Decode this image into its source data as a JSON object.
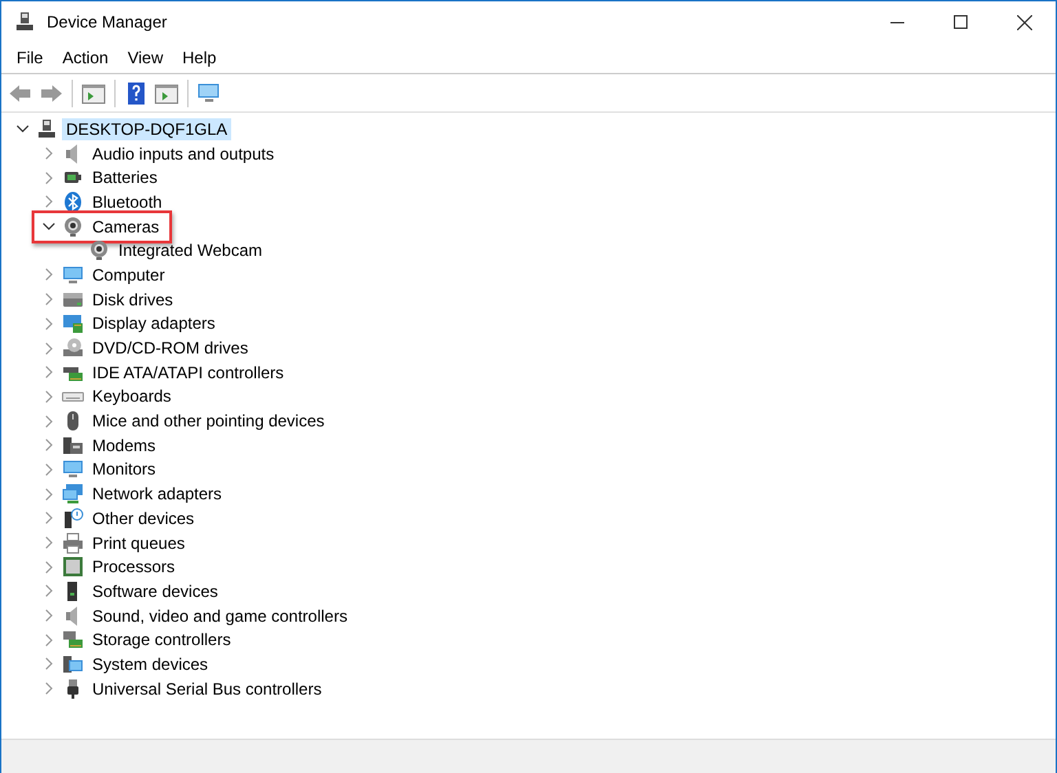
{
  "window": {
    "title": "Device Manager"
  },
  "menu": [
    "File",
    "Action",
    "View",
    "Help"
  ],
  "tree": [
    {
      "label": "DESKTOP-DQF1GLA",
      "selected": true,
      "expanded": true,
      "highlighted": false,
      "children": [
        {
          "label": "Audio inputs and outputs",
          "selected": false,
          "expanded": false,
          "highlighted": false
        },
        {
          "label": "Batteries",
          "selected": false,
          "expanded": false,
          "highlighted": false
        },
        {
          "label": "Bluetooth",
          "selected": false,
          "expanded": false,
          "highlighted": false
        },
        {
          "label": "Cameras",
          "selected": false,
          "expanded": true,
          "highlighted": true,
          "children": [
            {
              "label": "Integrated Webcam",
              "selected": false,
              "highlighted": false
            }
          ]
        },
        {
          "label": "Computer",
          "selected": false,
          "expanded": false,
          "highlighted": false
        },
        {
          "label": "Disk drives",
          "selected": false,
          "expanded": false,
          "highlighted": false
        },
        {
          "label": "Display adapters",
          "selected": false,
          "expanded": false,
          "highlighted": false
        },
        {
          "label": "DVD/CD-ROM drives",
          "selected": false,
          "expanded": false,
          "highlighted": false
        },
        {
          "label": "IDE ATA/ATAPI controllers",
          "selected": false,
          "expanded": false,
          "highlighted": false
        },
        {
          "label": "Keyboards",
          "selected": false,
          "expanded": false,
          "highlighted": false
        },
        {
          "label": "Mice and other pointing devices",
          "selected": false,
          "expanded": false,
          "highlighted": false
        },
        {
          "label": "Modems",
          "selected": false,
          "expanded": false,
          "highlighted": false
        },
        {
          "label": "Monitors",
          "selected": false,
          "expanded": false,
          "highlighted": false
        },
        {
          "label": "Network adapters",
          "selected": false,
          "expanded": false,
          "highlighted": false
        },
        {
          "label": "Other devices",
          "selected": false,
          "expanded": false,
          "highlighted": false
        },
        {
          "label": "Print queues",
          "selected": false,
          "expanded": false,
          "highlighted": false
        },
        {
          "label": "Processors",
          "selected": false,
          "expanded": false,
          "highlighted": false
        },
        {
          "label": "Software devices",
          "selected": false,
          "expanded": false,
          "highlighted": false
        },
        {
          "label": "Sound, video and game controllers",
          "selected": false,
          "expanded": false,
          "highlighted": false
        },
        {
          "label": "Storage controllers",
          "selected": false,
          "expanded": false,
          "highlighted": false
        },
        {
          "label": "System devices",
          "selected": false,
          "expanded": false,
          "highlighted": false
        },
        {
          "label": "Universal Serial Bus controllers",
          "selected": false,
          "expanded": false,
          "highlighted": false
        }
      ]
    }
  ]
}
